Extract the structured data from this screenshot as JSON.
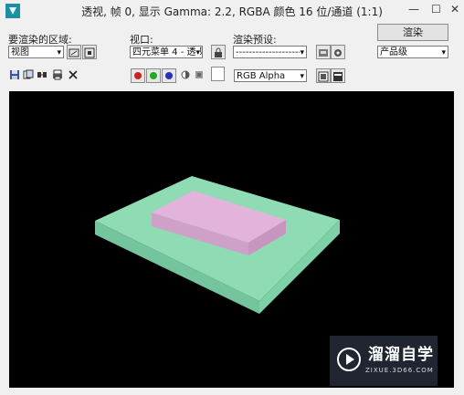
{
  "window": {
    "title": "透视, 帧 0, 显示 Gamma: 2.2, RGBA 颜色 16 位/通道 (1:1)"
  },
  "row1": {
    "area_label": "要渲染的区域:",
    "area_value": "视图",
    "viewport_label": "视口:",
    "viewport_value": "四元菜单 4 - 透视",
    "preset_label": "渲染预设:",
    "preset_value": "--------------------",
    "render_button": "渲染",
    "quality_value": "产品级"
  },
  "toolbar": {
    "channel_value": "RGB Alpha",
    "colors": {
      "red": "#cc2222",
      "green": "#22aa22",
      "blue": "#2233bb"
    }
  },
  "scene": {
    "background": "#000000",
    "base_color": "#8fdcb4",
    "box_color": "#e2b4dc"
  },
  "watermark": {
    "brand": "溜溜自学",
    "url": "ZIXUE.3D66.COM"
  }
}
